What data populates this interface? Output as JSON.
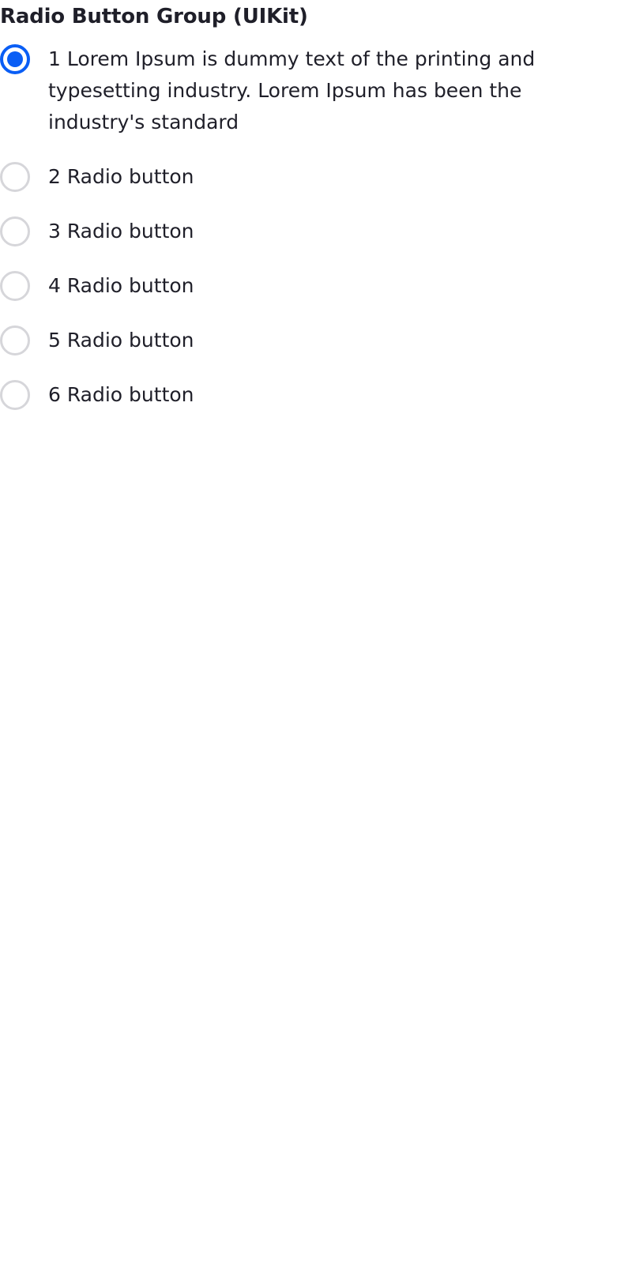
{
  "header": {
    "title": "Radio Button Group (UIKit)"
  },
  "radio_group": {
    "selected_index": 0,
    "accent_color": "#0a5ef5",
    "unselected_border_color": "#d6d6da",
    "options": [
      {
        "label": "1 Lorem Ipsum is dummy text of the printing and typesetting industry. Lorem Ipsum has been the industry's standard",
        "checked": true
      },
      {
        "label": "2 Radio button",
        "checked": false
      },
      {
        "label": "3 Radio button",
        "checked": false
      },
      {
        "label": "4 Radio button",
        "checked": false
      },
      {
        "label": "5 Radio button",
        "checked": false
      },
      {
        "label": "6 Radio button",
        "checked": false
      }
    ]
  }
}
